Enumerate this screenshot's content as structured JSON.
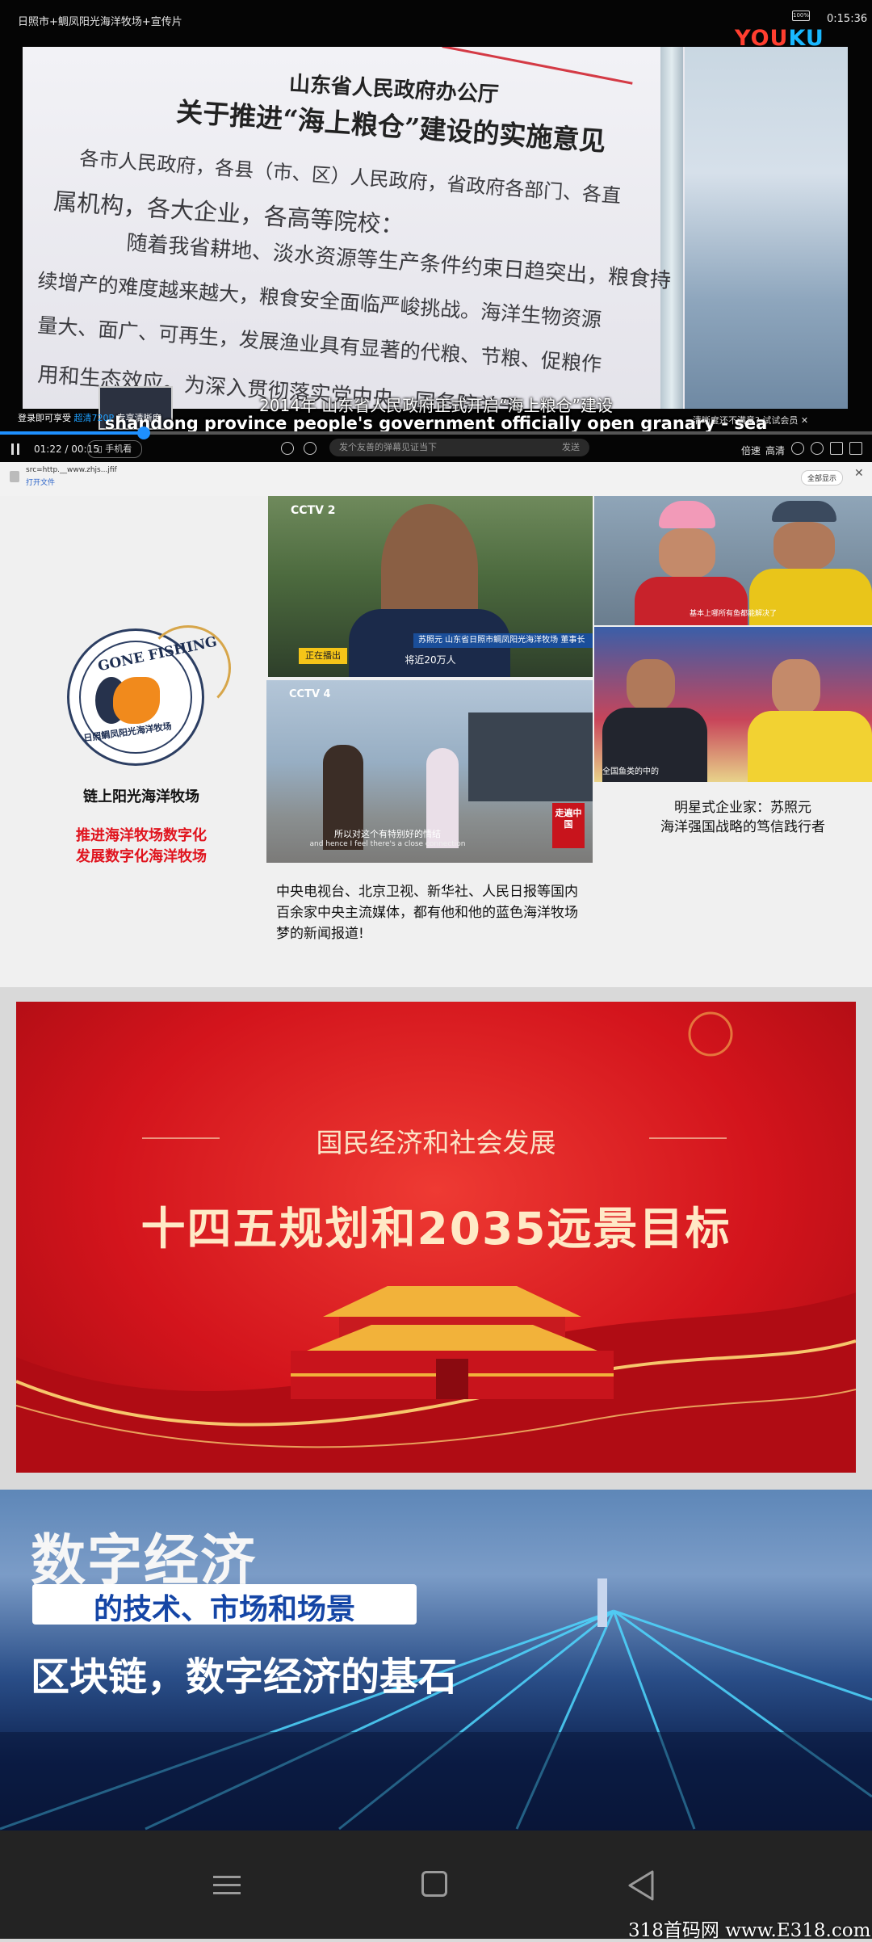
{
  "video": {
    "title": "日照市+鲷凤阳光海洋牧场+宣传片",
    "clock": "0:15:36",
    "battery": "100%",
    "brand_left": "YOU",
    "brand_right": "KU",
    "doc_heading_1": "山东省人民政府办公厅",
    "doc_heading_2": "关于推进“海上粮仓”建设的实施意见",
    "doc_lines": [
      "各市人民政府，各县（市、区）人民政府，省政府各部门、各直",
      "属机构，各大企业，各高等院校：",
      "随着我省耕地、淡水资源等生产条件约束日趋突出，粮食持",
      "续增产的难度越来越大，粮食安全面临严峻挑战。海洋生物资源",
      "量大、面广、可再生，发展渔业具有显著的代粮、节粮、促粮作",
      "用和生态效应。为深入贯彻落实党中央、国务院关于"
    ],
    "subtitle_cn": "2014年 山东省人民政府正式开启“海上粮仓”建设",
    "subtitle_en": "shandong province people's government officially open granary - sea",
    "promo_left_1": "登录即可享受",
    "promo_left_2": "超清720P",
    "promo_left_3": "专享清晰度",
    "promo_right": "清晰度还不满意? 试试会员 ✕",
    "time_current": "01:22",
    "time_total": "00:15",
    "phone_watch": "手机看",
    "danmu_placeholder": "发个友善的弹幕见证当下",
    "danmu_send": "发送",
    "speed": "倍速",
    "quality": "高清",
    "subtitle_btn": "字幕"
  },
  "browser": {
    "url": "src=http.__www.zhjs...jfif",
    "open_file": "打开文件",
    "fullscreen": "全部显示",
    "close": "✕"
  },
  "section2": {
    "logo_top": "GONE FISHING",
    "logo_bottom": "日照鲷凤阳光海洋牧场",
    "company": "链上阳光海洋牧场",
    "slogan_1": "推进海洋牧场数字化",
    "slogan_2": "发展数字化海洋牧场",
    "tile1_lower": "苏照元  山东省日照市鲷凤阳光海洋牧场 董事长",
    "tile1_sub": "将近20万人",
    "tile1_tag": "正在播出",
    "tile2_caption": "基本上哪所有鱼都能解决了",
    "tile3_sub_cn": "所以对这个有特别好的情结",
    "tile3_sub_en": "and hence I feel there's a close connection",
    "tile3_show": "走遍中国",
    "tile4_sub": "全国鱼类的中的",
    "caption_left": "中央电视台、北京卫视、新华社、人民日报等国内百余家中央主流媒体，都有他和他的蓝色海洋牧场梦的新闻报道!",
    "caption_right_1": "明星式企业家：苏照元",
    "caption_right_2": "海洋强国战略的笃信践行者"
  },
  "section3": {
    "subtitle": "国民经济和社会发展",
    "title": "十四五规划和2035远景目标"
  },
  "section4": {
    "title_1": "数字经济",
    "title_2": "的技术、市场和场景",
    "title_3": "区块链，数字经济的基石"
  },
  "watermark": "318首码网  www.E318.com",
  "colors": {
    "accent_blue": "#1e90ff",
    "slogan_red": "#e0141e",
    "banner_red": "#d3141c"
  }
}
